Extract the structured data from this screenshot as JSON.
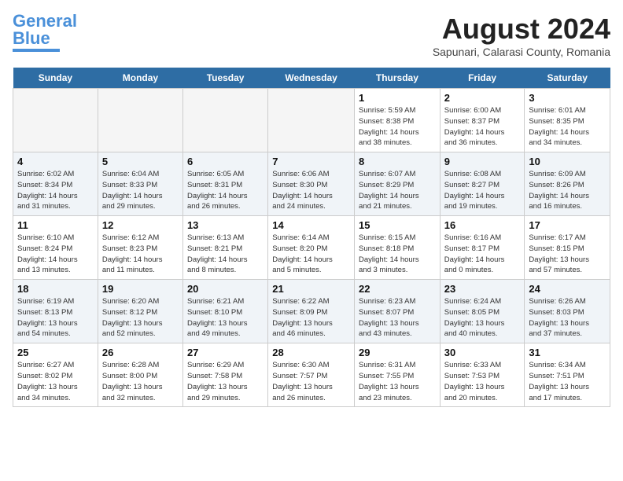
{
  "header": {
    "logo_line1": "General",
    "logo_line2": "Blue",
    "month_year": "August 2024",
    "location": "Sapunari, Calarasi County, Romania"
  },
  "days_of_week": [
    "Sunday",
    "Monday",
    "Tuesday",
    "Wednesday",
    "Thursday",
    "Friday",
    "Saturday"
  ],
  "weeks": [
    [
      {
        "day": "",
        "info": ""
      },
      {
        "day": "",
        "info": ""
      },
      {
        "day": "",
        "info": ""
      },
      {
        "day": "",
        "info": ""
      },
      {
        "day": "1",
        "info": "Sunrise: 5:59 AM\nSunset: 8:38 PM\nDaylight: 14 hours\nand 38 minutes."
      },
      {
        "day": "2",
        "info": "Sunrise: 6:00 AM\nSunset: 8:37 PM\nDaylight: 14 hours\nand 36 minutes."
      },
      {
        "day": "3",
        "info": "Sunrise: 6:01 AM\nSunset: 8:35 PM\nDaylight: 14 hours\nand 34 minutes."
      }
    ],
    [
      {
        "day": "4",
        "info": "Sunrise: 6:02 AM\nSunset: 8:34 PM\nDaylight: 14 hours\nand 31 minutes."
      },
      {
        "day": "5",
        "info": "Sunrise: 6:04 AM\nSunset: 8:33 PM\nDaylight: 14 hours\nand 29 minutes."
      },
      {
        "day": "6",
        "info": "Sunrise: 6:05 AM\nSunset: 8:31 PM\nDaylight: 14 hours\nand 26 minutes."
      },
      {
        "day": "7",
        "info": "Sunrise: 6:06 AM\nSunset: 8:30 PM\nDaylight: 14 hours\nand 24 minutes."
      },
      {
        "day": "8",
        "info": "Sunrise: 6:07 AM\nSunset: 8:29 PM\nDaylight: 14 hours\nand 21 minutes."
      },
      {
        "day": "9",
        "info": "Sunrise: 6:08 AM\nSunset: 8:27 PM\nDaylight: 14 hours\nand 19 minutes."
      },
      {
        "day": "10",
        "info": "Sunrise: 6:09 AM\nSunset: 8:26 PM\nDaylight: 14 hours\nand 16 minutes."
      }
    ],
    [
      {
        "day": "11",
        "info": "Sunrise: 6:10 AM\nSunset: 8:24 PM\nDaylight: 14 hours\nand 13 minutes."
      },
      {
        "day": "12",
        "info": "Sunrise: 6:12 AM\nSunset: 8:23 PM\nDaylight: 14 hours\nand 11 minutes."
      },
      {
        "day": "13",
        "info": "Sunrise: 6:13 AM\nSunset: 8:21 PM\nDaylight: 14 hours\nand 8 minutes."
      },
      {
        "day": "14",
        "info": "Sunrise: 6:14 AM\nSunset: 8:20 PM\nDaylight: 14 hours\nand 5 minutes."
      },
      {
        "day": "15",
        "info": "Sunrise: 6:15 AM\nSunset: 8:18 PM\nDaylight: 14 hours\nand 3 minutes."
      },
      {
        "day": "16",
        "info": "Sunrise: 6:16 AM\nSunset: 8:17 PM\nDaylight: 14 hours\nand 0 minutes."
      },
      {
        "day": "17",
        "info": "Sunrise: 6:17 AM\nSunset: 8:15 PM\nDaylight: 13 hours\nand 57 minutes."
      }
    ],
    [
      {
        "day": "18",
        "info": "Sunrise: 6:19 AM\nSunset: 8:13 PM\nDaylight: 13 hours\nand 54 minutes."
      },
      {
        "day": "19",
        "info": "Sunrise: 6:20 AM\nSunset: 8:12 PM\nDaylight: 13 hours\nand 52 minutes."
      },
      {
        "day": "20",
        "info": "Sunrise: 6:21 AM\nSunset: 8:10 PM\nDaylight: 13 hours\nand 49 minutes."
      },
      {
        "day": "21",
        "info": "Sunrise: 6:22 AM\nSunset: 8:09 PM\nDaylight: 13 hours\nand 46 minutes."
      },
      {
        "day": "22",
        "info": "Sunrise: 6:23 AM\nSunset: 8:07 PM\nDaylight: 13 hours\nand 43 minutes."
      },
      {
        "day": "23",
        "info": "Sunrise: 6:24 AM\nSunset: 8:05 PM\nDaylight: 13 hours\nand 40 minutes."
      },
      {
        "day": "24",
        "info": "Sunrise: 6:26 AM\nSunset: 8:03 PM\nDaylight: 13 hours\nand 37 minutes."
      }
    ],
    [
      {
        "day": "25",
        "info": "Sunrise: 6:27 AM\nSunset: 8:02 PM\nDaylight: 13 hours\nand 34 minutes."
      },
      {
        "day": "26",
        "info": "Sunrise: 6:28 AM\nSunset: 8:00 PM\nDaylight: 13 hours\nand 32 minutes."
      },
      {
        "day": "27",
        "info": "Sunrise: 6:29 AM\nSunset: 7:58 PM\nDaylight: 13 hours\nand 29 minutes."
      },
      {
        "day": "28",
        "info": "Sunrise: 6:30 AM\nSunset: 7:57 PM\nDaylight: 13 hours\nand 26 minutes."
      },
      {
        "day": "29",
        "info": "Sunrise: 6:31 AM\nSunset: 7:55 PM\nDaylight: 13 hours\nand 23 minutes."
      },
      {
        "day": "30",
        "info": "Sunrise: 6:33 AM\nSunset: 7:53 PM\nDaylight: 13 hours\nand 20 minutes."
      },
      {
        "day": "31",
        "info": "Sunrise: 6:34 AM\nSunset: 7:51 PM\nDaylight: 13 hours\nand 17 minutes."
      }
    ]
  ]
}
